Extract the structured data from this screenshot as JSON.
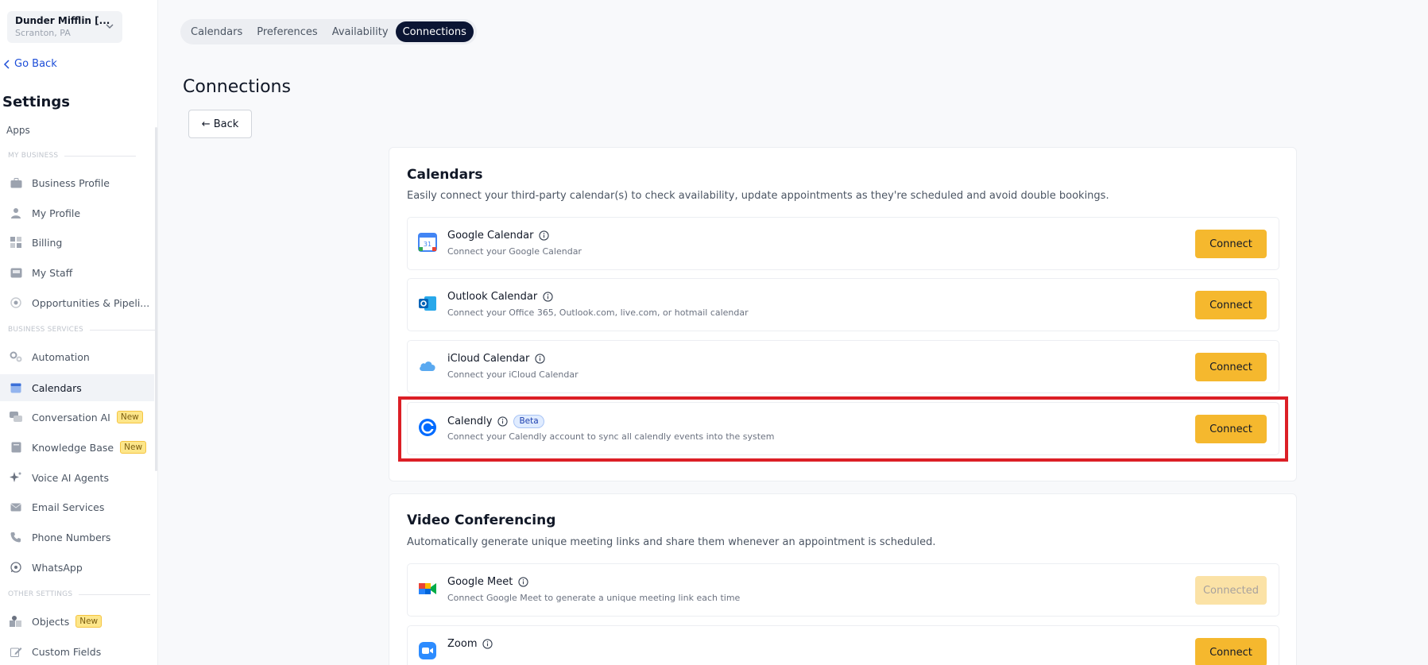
{
  "location": {
    "name": "Dunder Mifflin [...",
    "city": "Scranton, PA"
  },
  "sidebar": {
    "go_back": "Go Back",
    "title": "Settings",
    "apps": "Apps",
    "sections": [
      "MY BUSINESS",
      "BUSINESS SERVICES",
      "OTHER SETTINGS"
    ],
    "items": [
      {
        "label": "Business Profile",
        "icon": "briefcase-icon"
      },
      {
        "label": "My Profile",
        "icon": "person-icon"
      },
      {
        "label": "Billing",
        "icon": "grid-icon"
      },
      {
        "label": "My Staff",
        "icon": "staff-icon"
      },
      {
        "label": "Opportunities & Pipeli...",
        "icon": "target-icon"
      },
      {
        "label": "Automation",
        "icon": "gears-icon"
      },
      {
        "label": "Calendars",
        "icon": "calendar-icon"
      },
      {
        "label": "Conversation AI",
        "icon": "chat-icon",
        "badge": "New"
      },
      {
        "label": "Knowledge Base",
        "icon": "book-icon",
        "badge": "New"
      },
      {
        "label": "Voice AI Agents",
        "icon": "sparkle-icon"
      },
      {
        "label": "Email Services",
        "icon": "mail-icon"
      },
      {
        "label": "Phone Numbers",
        "icon": "phone-icon"
      },
      {
        "label": "WhatsApp",
        "icon": "whatsapp-icon"
      },
      {
        "label": "Objects",
        "icon": "objects-icon",
        "badge": "New"
      },
      {
        "label": "Custom Fields",
        "icon": "edit-icon"
      }
    ]
  },
  "tabs": [
    "Calendars",
    "Preferences",
    "Availability",
    "Connections"
  ],
  "active_tab": "Connections",
  "page_title": "Connections",
  "back_label": "← Back",
  "calendars": {
    "title": "Calendars",
    "subtitle": "Easily connect your third-party calendar(s) to check availability, update appointments as they're scheduled and avoid double bookings.",
    "items": [
      {
        "name": "Google Calendar",
        "desc": "Connect your Google Calendar",
        "button": "Connect"
      },
      {
        "name": "Outlook Calendar",
        "desc": "Connect your Office 365, Outlook.com, live.com, or hotmail calendar",
        "button": "Connect"
      },
      {
        "name": "iCloud Calendar",
        "desc": "Connect your iCloud Calendar",
        "button": "Connect"
      },
      {
        "name": "Calendly",
        "badge": "Beta",
        "desc": "Connect your Calendly account to sync all calendly events into the system",
        "button": "Connect"
      }
    ]
  },
  "video": {
    "title": "Video Conferencing",
    "subtitle": "Automatically generate unique meeting links and share them whenever an appointment is scheduled.",
    "items": [
      {
        "name": "Google Meet",
        "desc": "Connect Google Meet to generate a unique meeting link each time",
        "button": "Connected"
      },
      {
        "name": "Zoom",
        "desc": "",
        "button": "Connect"
      }
    ]
  },
  "colors": {
    "accent": "#f5b82e",
    "active_tab": "#0b1533",
    "highlight": "#dc1f26"
  }
}
